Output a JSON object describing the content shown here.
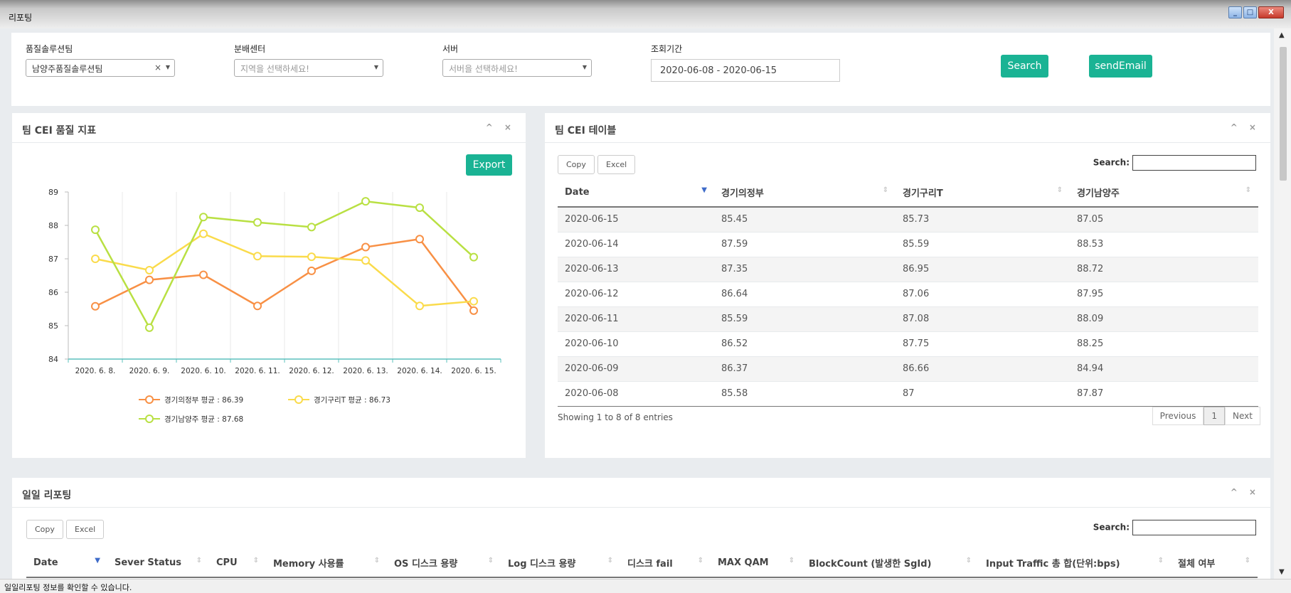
{
  "window": {
    "title": "리포팅",
    "buttons": {
      "minimize": "_",
      "maximize": "□",
      "close": "X"
    }
  },
  "filters": {
    "team": {
      "label": "품질솔루션팀",
      "value": "남양주품질솔루션팀",
      "clear": "×"
    },
    "center": {
      "label": "분배센터",
      "placeholder": "지역을 선택하세요!"
    },
    "server": {
      "label": "서버",
      "placeholder": "서버을 선택하세요!"
    },
    "period": {
      "label": "조회기간",
      "value": "2020-06-08 - 2020-06-15"
    },
    "search_button": "Search",
    "send_email_button": "sendEmail"
  },
  "chart_panel": {
    "title": "팀 CEI 품질 지표",
    "export_button": "Export",
    "tools": "^ ×"
  },
  "chart_data": {
    "type": "line",
    "categories": [
      "2020. 6. 8.",
      "2020. 6. 9.",
      "2020. 6. 10.",
      "2020. 6. 11.",
      "2020. 6. 12.",
      "2020. 6. 13.",
      "2020. 6. 14.",
      "2020. 6. 15."
    ],
    "ylim": [
      84,
      89
    ],
    "yticks": [
      "84",
      "85",
      "86",
      "87",
      "88",
      "89"
    ],
    "grid": true,
    "legend_position": "bottom",
    "series": [
      {
        "name": "경기의정부 평균 : 86.39",
        "color": "#f89045",
        "values": [
          85.58,
          86.37,
          86.52,
          85.59,
          86.64,
          87.35,
          87.59,
          85.45
        ]
      },
      {
        "name": "경기구리T 평균 : 86.73",
        "color": "#fadb4b",
        "values": [
          87,
          86.66,
          87.75,
          87.08,
          87.06,
          86.95,
          85.59,
          85.73
        ]
      },
      {
        "name": "경기남양주 평균 : 87.68",
        "color": "#b9e043",
        "values": [
          87.87,
          84.94,
          88.25,
          88.09,
          87.95,
          88.72,
          88.53,
          87.05
        ]
      }
    ]
  },
  "table_panel": {
    "title": "팀 CEI 테이블",
    "tools": "^ ×",
    "copy": "Copy",
    "excel": "Excel",
    "search_label": "Search:",
    "headers": [
      "Date",
      "경기의정부",
      "경기구리T",
      "경기남양주"
    ],
    "rows": [
      [
        "2020-06-15",
        "85.45",
        "85.73",
        "87.05"
      ],
      [
        "2020-06-14",
        "87.59",
        "85.59",
        "88.53"
      ],
      [
        "2020-06-13",
        "87.35",
        "86.95",
        "88.72"
      ],
      [
        "2020-06-12",
        "86.64",
        "87.06",
        "87.95"
      ],
      [
        "2020-06-11",
        "85.59",
        "87.08",
        "88.09"
      ],
      [
        "2020-06-10",
        "86.52",
        "87.75",
        "88.25"
      ],
      [
        "2020-06-09",
        "86.37",
        "86.66",
        "84.94"
      ],
      [
        "2020-06-08",
        "85.58",
        "87",
        "87.87"
      ]
    ],
    "info": "Showing 1 to 8 of 8 entries",
    "pager": {
      "previous": "Previous",
      "page": "1",
      "next": "Next"
    }
  },
  "daily_panel": {
    "title": "일일 리포팅",
    "tools": "^ ×",
    "copy": "Copy",
    "excel": "Excel",
    "search_label": "Search:",
    "headers": [
      "Date",
      "Sever Status",
      "CPU",
      "Memory 사용률",
      "OS 디스크 용량",
      "Log 디스크 용량",
      "디스크 fail",
      "MAX QAM",
      "BlockCount (발생한 SgId)",
      "Input Traffic 총 합(단위:bps)",
      "절체 여부"
    ]
  },
  "status_text": "일일리포팅 정보를 확인할 수 있습니다."
}
